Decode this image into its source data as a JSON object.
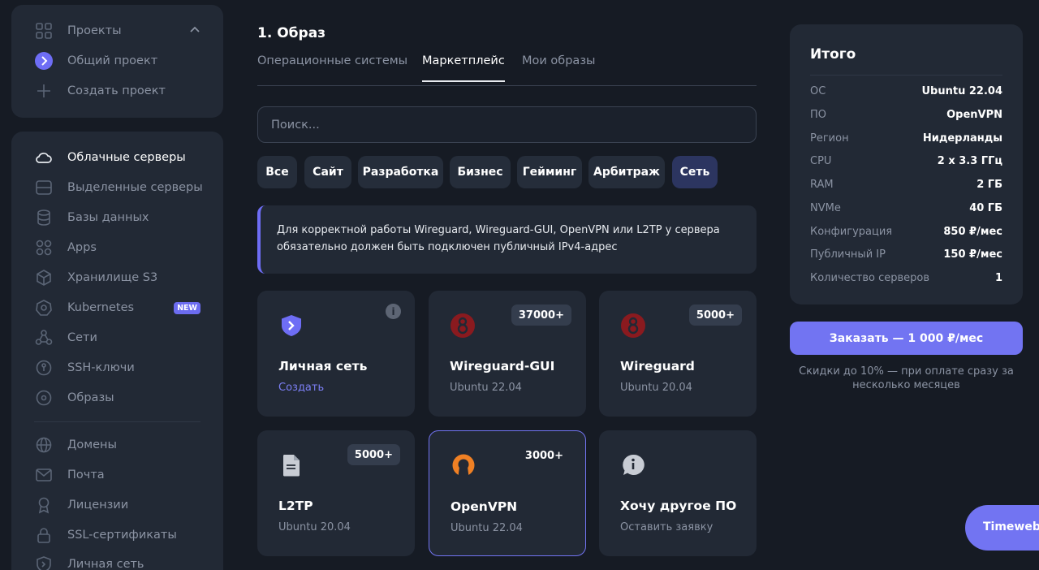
{
  "sidebar": {
    "projects": {
      "header": "Проекты",
      "current": "Общий проект",
      "create": "Создать проект"
    },
    "nav": [
      {
        "label": "Облачные серверы",
        "icon": "cloud-icon",
        "active": true
      },
      {
        "label": "Выделенные серверы",
        "icon": "server-icon"
      },
      {
        "label": "Базы данных",
        "icon": "database-icon"
      },
      {
        "label": "Apps",
        "icon": "apps-icon"
      },
      {
        "label": "Хранилище S3",
        "icon": "cube-icon"
      },
      {
        "label": "Kubernetes",
        "icon": "kubernetes-icon",
        "badge": "NEW"
      },
      {
        "label": "Сети",
        "icon": "network-icon"
      },
      {
        "label": "SSH-ключи",
        "icon": "key-icon"
      },
      {
        "label": "Образы",
        "icon": "disc-icon"
      }
    ],
    "nav2": [
      {
        "label": "Домены",
        "icon": "globe-icon"
      },
      {
        "label": "Почта",
        "icon": "mail-icon"
      },
      {
        "label": "Лицензии",
        "icon": "award-icon"
      },
      {
        "label": "SSL-сертификаты",
        "icon": "lock-icon"
      },
      {
        "label": "Личная сеть",
        "icon": "shield-icon"
      }
    ]
  },
  "main": {
    "heading": "1. Образ",
    "tabs": [
      "Операционные системы",
      "Маркетплейс",
      "Мои образы"
    ],
    "active_tab": "Маркетплейс",
    "search_placeholder": "Поиск...",
    "chips": [
      "Все",
      "Сайт",
      "Разработка",
      "Бизнес",
      "Гейминг",
      "Арбитраж",
      "Сеть"
    ],
    "active_chip": "Сеть",
    "notice": "Для корректной работы Wireguard, Wireguard-GUI, OpenVPN или L2TP у сервера обязательно должен быть подключен публичный IPv4-адрес",
    "cards": [
      {
        "title": "Личная сеть",
        "sub": "Создать",
        "icon": "shield-chevron-icon",
        "info": "i"
      },
      {
        "title": "Wireguard-GUI",
        "sub": "Ubuntu 22.04",
        "icon": "wireguard-icon",
        "badge": "37000+"
      },
      {
        "title": "Wireguard",
        "sub": "Ubuntu 20.04",
        "icon": "wireguard-icon",
        "badge": "5000+"
      },
      {
        "title": "L2TP",
        "sub": "Ubuntu 20.04",
        "icon": "file-icon",
        "badge": "5000+"
      },
      {
        "title": "OpenVPN",
        "sub": "Ubuntu 22.04",
        "icon": "openvpn-icon",
        "badge": "3000+",
        "selected": true
      },
      {
        "title": "Хочу другое ПО",
        "sub": "Оставить заявку",
        "icon": "chat-info-icon"
      }
    ]
  },
  "summary": {
    "title": "Итого",
    "rows": [
      {
        "k": "ОС",
        "v": "Ubuntu 22.04"
      },
      {
        "k": "ПО",
        "v": "OpenVPN"
      },
      {
        "k": "Регион",
        "v": "Нидерланды"
      },
      {
        "k": "CPU",
        "v": "2 x 3.3 ГГц"
      },
      {
        "k": "RAM",
        "v": "2 ГБ"
      },
      {
        "k": "NVMe",
        "v": "40 ГБ"
      },
      {
        "k": "Конфигурация",
        "v": "850 ₽/мес"
      },
      {
        "k": "Публичный IP",
        "v": "150 ₽/мес"
      },
      {
        "k": "Количество серверов",
        "v": "1"
      }
    ],
    "order_button": "Заказать — 1 000 ₽/мес",
    "discount_note": "Скидки до 10% — при оплате сразу за несколько месяцев"
  },
  "floating": {
    "label": "TimewebC"
  },
  "colors": {
    "accent": "#7274f2",
    "panel": "#222935",
    "background": "#161b24"
  }
}
